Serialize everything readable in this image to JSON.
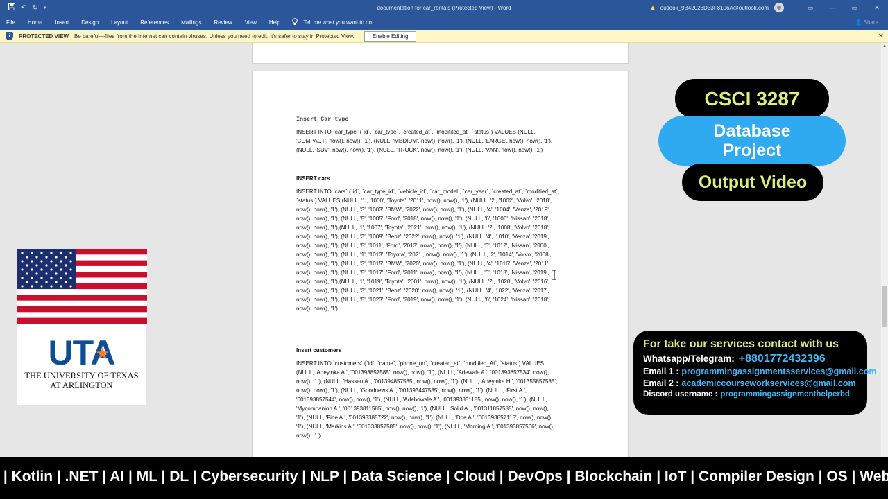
{
  "titlebar": {
    "doc_title": "documentation for car_rentals (Protected View) - Word",
    "account": "outlook_9B42028D33F8106A@outlook.com",
    "save_icon": "save-icon",
    "undo_icon": "undo-icon",
    "redo_icon": "redo-icon",
    "minimize": "—",
    "restore": "▭",
    "close": "✕",
    "ribbon_display": "▭"
  },
  "ribbon": {
    "tabs": [
      "File",
      "Home",
      "Insert",
      "Design",
      "Layout",
      "References",
      "Mailings",
      "Review",
      "View",
      "Help"
    ],
    "tell_me": "Tell me what you want to do",
    "share": "Share"
  },
  "protected_view": {
    "label": "PROTECTED VIEW",
    "message": "Be careful—files from the Internet can contain viruses. Unless you need to edit, it's safer to stay in Protected View.",
    "button": "Enable Editing",
    "close": "✕"
  },
  "document": {
    "sections": [
      {
        "heading": "Insert Car_type",
        "lines": [
          "INSERT INTO `car_type` (`id`, `car_type`, `created_at`, `modifited_at`, `status`) VALUES (NULL,",
          "'COMPACT', now(), now(), '1'), (NULL, 'MEDIUM', now(), now(), '1'), (NULL, 'LARGE', now(), now(), '1'),",
          "(NULL, 'SUV', now(), now(), '1'), (NULL, 'TRUCK', now(), now(), '1'), (NULL, 'VAN', now(), now(), '1')"
        ]
      },
      {
        "heading": "INSERT cars",
        "lines": [
          "INSERT INTO `cars` (`id`, `car_type_id`, `vehicle_id`, `car_model`, `car_year`, `created_at`, `modified_at`,",
          "`status`) VALUES (NULL, '1', '1000', 'Toyota', '2011', now(), now(), '1'), (NULL, '2', '1002', 'Volvo', '2018',",
          "now(), now(), '1'), (NULL, '3', '1003', 'BMW', '2022', now(), now(), '1'), (NULL, '4', '1004', 'Venza', '2019',",
          "now(), now(), '1'), (NULL, '5', '1005', 'Ford', '2018', now(), now(), '1'), (NULL, '6', '1006', 'Nissan', '2018',",
          "now(), now(), '1'),(NULL, '1', '1007', 'Toyota', '2021', now(), now(), '1'), (NULL, '2', '1008', 'Volvo', '2018',",
          "now(), now(), '1'), (NULL, '3', '1009', 'Benz', '2022', now(), now(), '1'), (NULL, '4', '1010', 'Venza', '2019',",
          "now(), now(), '1'), (NULL, '5', '1011', 'Ford', '2013', now(), now(), '1'), (NULL, '6', '1012', 'Nissan', '2000',",
          "now(), now(), '1'), (NULL, '1', '1013', 'Toyota', '2021', now(), now(), '1'), (NULL, '2', '1014', 'Volvo', '2008',",
          "now(), now(), '1'), (NULL, '3', '1015', 'BMW', '2020', now(), now(), '1'), (NULL, '4', '1016', 'Venza', '2011',",
          "now(), now(), '1'), (NULL, '5', '1017', 'Ford', '2011', now(), now(), '1'), (NULL, '6', '1018', 'Nissan', '2019',",
          "now(), now(), '1'),(NULL, '1', '1019', 'Toyota', '2001', now(), now(), '1'), (NULL, '2', '1020', 'Volvo', '2016',",
          "now(), now(), '1'), (NULL, '3', '1021', 'Benz', '2020', now(), now(), '1'), (NULL, '4', '1022', 'Venza', '2017',",
          "now(), now(), '1'), (NULL, '5', '1023', 'Ford', '2019', now(), now(), '1'), (NULL, '6', '1024', 'Nissan', '2018',",
          "now(), now(), '1')"
        ]
      },
      {
        "heading": "Insert customers",
        "lines": [
          "INSERT INTO `customers` (`id`, `name`, `phone_no`, `created_at`, `modified_At`, `status`) VALUES",
          "(NULL, 'Adeyinka A.', '001393857585', now(), now(), '1'), (NULL, 'Adewale A.', '001393857534', now(),",
          "now(), '1'), (NULL, 'Hassan A.', '001394857585', now(), now(), '1'), (NULL, 'Adeyinka H.', '001355857585',",
          "now(), now(), '1'), (NULL, 'Goodnews A.', '001393447585', now(), now(), '1'), (NULL, 'First A.',",
          "'001393857544', now(), now(), '1'), (NULL, 'Adebowale A.', '001393851185', now(), now(), '1'), (NULL,",
          "'Mycompanion A.', '001393811585', now(), now(), '1'), (NULL, 'Solid A.', '001311857585', now(), now(),",
          "'1'), (NULL, 'Fine A.', '001393385722', now(), now(), '1'), (NULL, 'Doe A.', '001393857115', now(), now(),",
          "'1'), (NULL, 'Markins A.', '001333857585', now(), now(), '1'), (NULL, 'Morning A.', '001393857566', now(),",
          "now(), '1')"
        ]
      }
    ]
  },
  "overlay": {
    "course": "CSCI 3287",
    "project_line1": "Database",
    "project_line2": "Project",
    "output": "Output Video",
    "uta": "UTA",
    "uta_line1": "THE UNIVERSITY OF TEXAS",
    "uta_line2": "AT ARLINGTON",
    "contact": {
      "title": "For take our services contact with us",
      "whatsapp_label": "Whatsapp/Telegram:",
      "whatsapp_value": "+8801772432396",
      "email1_label": "Email 1 :",
      "email1_value": "programmingassignmentsservices@gmail.com",
      "email2_label": "Email 2 :",
      "email2_value": "academiccourseworkservices@gmail.com",
      "discord_label": "Discord username :",
      "discord_value": "programmingassignmenthelperbd"
    },
    "ticker": "t | Kotlin | .NET | AI | ML | DL | Cybersecurity | NLP | Data Science | Cloud | DevOps | Blockchain | IoT | Compiler Design | OS | Web Dev | Full S"
  },
  "colors": {
    "word_blue": "#2b579a",
    "badge_lime": "#d9f07b",
    "badge_blue": "#2fa9ef",
    "contact_blue": "#3db6f5"
  }
}
